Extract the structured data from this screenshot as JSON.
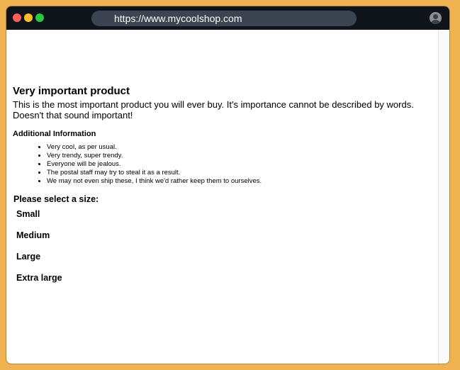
{
  "browser": {
    "url": "https://www.mycoolshop.com"
  },
  "product": {
    "title": "Very important product",
    "description": "This is the most important product you will ever buy. It's importance cannot be described by words. Doesn't that sound important!",
    "additional_info_heading": "Additional Information",
    "features": [
      "Very cool, as per usual.",
      "Very trendy, super trendy.",
      "Everyone will be jealous.",
      "The postal staff may try to steal it as a result.",
      "We may not even ship these, I think we'd rather keep them to ourselves."
    ]
  },
  "size_selector": {
    "prompt": "Please select a size:",
    "options": [
      "Small",
      "Medium",
      "Large",
      "Extra large"
    ]
  },
  "colors": {
    "background": "#f0b352",
    "titlebar": "#0f141a",
    "urlbar": "#3b4450"
  }
}
